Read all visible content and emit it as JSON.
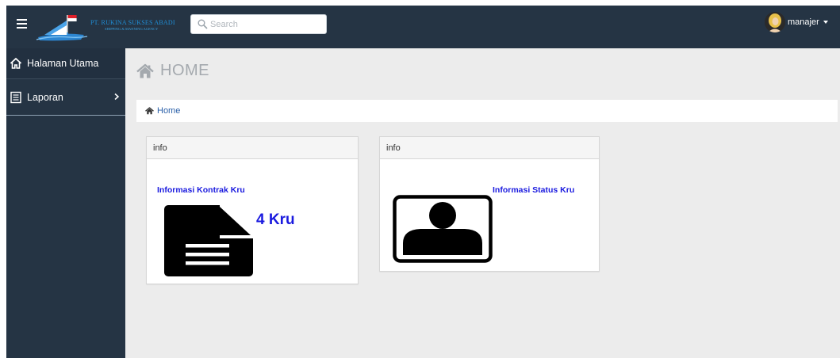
{
  "header": {
    "company_name": "PT. RUKINA SUKSES ABADI",
    "company_tagline": "SHIPPING & MANNING AGENCY",
    "search_placeholder": "Search",
    "username": "manajer"
  },
  "sidebar": {
    "items": [
      {
        "label": "Halaman Utama",
        "icon": "home-icon"
      },
      {
        "label": "Laporan",
        "icon": "document-icon"
      }
    ]
  },
  "page": {
    "title": "HOME",
    "breadcrumb": "Home"
  },
  "panels": [
    {
      "heading": "info",
      "link": "Informasi Kontrak Kru",
      "count": "4 Kru",
      "icon": "document-icon"
    },
    {
      "heading": "info",
      "link": "Informasi Status Kru",
      "icon": "user-portrait-icon"
    }
  ],
  "colors": {
    "navbar": "#253444",
    "content_bg": "#ececec",
    "link": "#1a1adf",
    "breadcrumb_link": "#2a5fa8"
  }
}
